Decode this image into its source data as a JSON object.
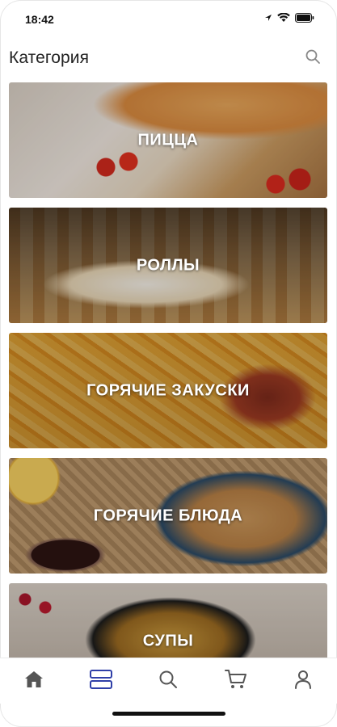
{
  "status_bar": {
    "time": "18:42",
    "icons": [
      "location-arrow-icon",
      "wifi-icon",
      "battery-icon"
    ]
  },
  "header": {
    "title": "Категория",
    "search_icon": "search-icon"
  },
  "categories": [
    {
      "label": "ПИЦЦА"
    },
    {
      "label": "РОЛЛЫ"
    },
    {
      "label": "ГОРЯЧИЕ ЗАКУСКИ"
    },
    {
      "label": "ГОРЯЧИЕ БЛЮДА"
    },
    {
      "label": "СУПЫ"
    }
  ],
  "bottom_nav": {
    "items": [
      {
        "icon": "home-icon",
        "active": false
      },
      {
        "icon": "categories-icon",
        "active": true
      },
      {
        "icon": "search-icon",
        "active": false
      },
      {
        "icon": "cart-icon",
        "active": false
      },
      {
        "icon": "profile-icon",
        "active": false
      }
    ]
  },
  "colors": {
    "accent": "#2f3fa8",
    "inactive_icon": "#555555",
    "title_text": "#222222"
  }
}
